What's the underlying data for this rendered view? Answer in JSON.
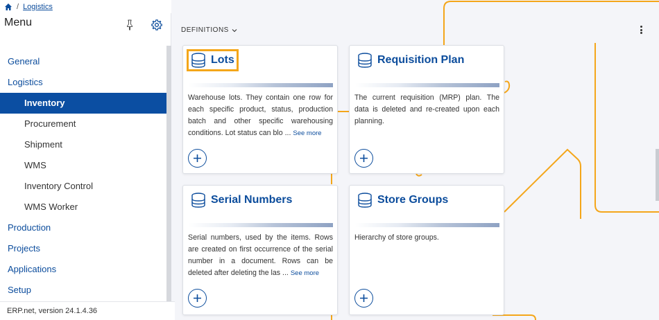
{
  "breadcrumb": {
    "home_icon": "home-icon",
    "separator": "/",
    "current": "Logistics"
  },
  "sidebar": {
    "title": "Menu",
    "pin_icon": "pin-icon",
    "settings_icon": "gear-icon",
    "items": [
      {
        "label": "General",
        "level": "top"
      },
      {
        "label": "Logistics",
        "level": "top"
      },
      {
        "label": "Inventory",
        "level": "sub",
        "active": true
      },
      {
        "label": "Procurement",
        "level": "sub"
      },
      {
        "label": "Shipment",
        "level": "sub"
      },
      {
        "label": "WMS",
        "level": "sub"
      },
      {
        "label": "Inventory Control",
        "level": "sub"
      },
      {
        "label": "WMS Worker",
        "level": "sub"
      },
      {
        "label": "Production",
        "level": "top"
      },
      {
        "label": "Projects",
        "level": "top"
      },
      {
        "label": "Applications",
        "level": "top"
      },
      {
        "label": "Setup",
        "level": "top"
      }
    ],
    "version": "ERP.net, version 24.1.4.36"
  },
  "main": {
    "section_label": "DEFINITIONS",
    "cards": [
      {
        "title": "Lots",
        "icon": "database-icon",
        "description": "Warehouse lots. They contain one row for each specific product, status, production batch and other specific warehousing conditions. Lot status can blo ...",
        "see_more": "See more",
        "add": "+"
      },
      {
        "title": "Requisition Plan",
        "icon": "database-icon",
        "description": "The current requisition (MRP) plan. The data is deleted and re-created upon each planning.",
        "see_more": "",
        "add": "+"
      },
      {
        "title": "Serial Numbers",
        "icon": "database-icon",
        "description": "Serial numbers, used by the items. Rows are created on first occurrence of the serial number in a document. Rows can be deleted after deleting the las ...",
        "see_more": "See more",
        "add": "+"
      },
      {
        "title": "Store Groups",
        "icon": "database-icon",
        "description": "Hierarchy of store groups.",
        "see_more": "",
        "add": "+"
      }
    ]
  },
  "colors": {
    "accent": "#0b4ea2",
    "link": "#0b4c9c",
    "connector": "#f4a61a",
    "focus": "#f4a61a"
  }
}
